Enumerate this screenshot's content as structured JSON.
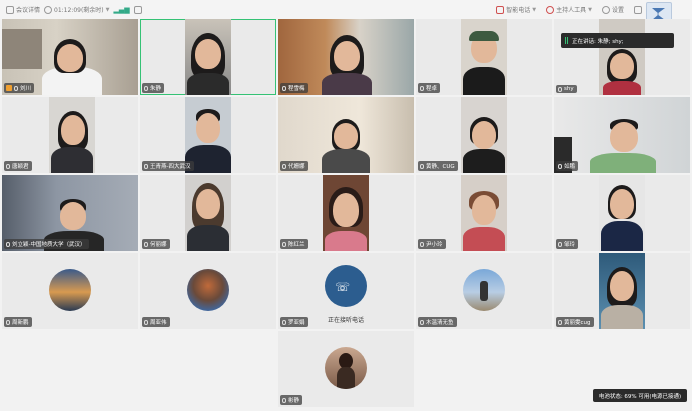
{
  "toolbar": {
    "meeting_info": "会议详情",
    "duration": "01:12:09(剩余时)",
    "phone": "智能电话",
    "host_tools": "主持人工具",
    "settings": "设置"
  },
  "speaking_notice": "正在讲话: 朱静; shy;",
  "network_status": "电池状态: 69% 可用(电源已接通)",
  "tiles": [
    {
      "name": "刘川",
      "host": true
    },
    {
      "name": "朱静",
      "active": true
    },
    {
      "name": "程雪梅"
    },
    {
      "name": "程卓"
    },
    {
      "name": "shy"
    },
    {
      "name": "唐颖君"
    },
    {
      "name": "王青燕-四大武汉"
    },
    {
      "name": "代姗娜"
    },
    {
      "name": "黄静、CUG"
    },
    {
      "name": "如鹏"
    },
    {
      "name": "刘立颖-中国地质大学（武汉）"
    },
    {
      "name": "何丽娜"
    },
    {
      "name": "陈红兰"
    },
    {
      "name": "尹小玲"
    },
    {
      "name": "邹玲"
    },
    {
      "name": "周新鹏"
    },
    {
      "name": "周亚伟"
    },
    {
      "name": "罗亚娟",
      "phone_text": "正在接听电话"
    },
    {
      "name": "木温清无鱼"
    },
    {
      "name": "黄丽雯cug"
    },
    {
      "name": "彬静"
    }
  ]
}
